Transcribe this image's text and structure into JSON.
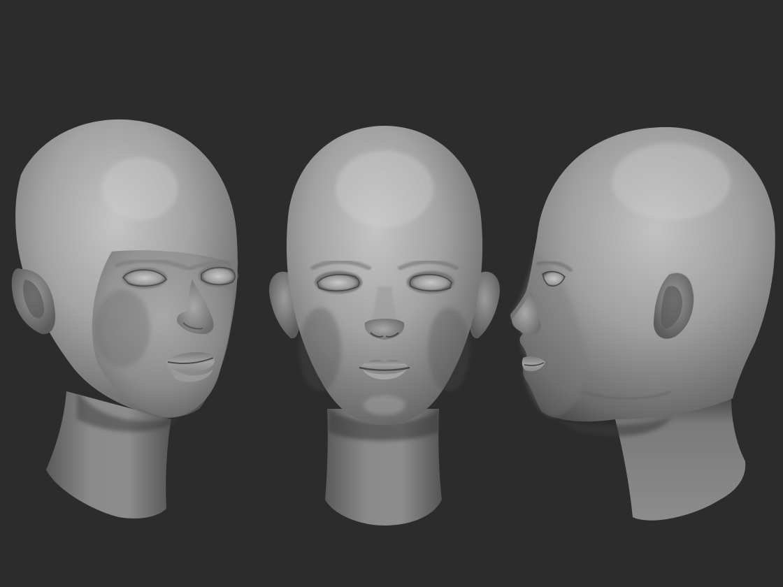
{
  "scene": {
    "background_color": "#2c2c2c",
    "material_color": "#8f8f8f",
    "subject": "sculpted-head",
    "views": [
      {
        "name": "three-quarter-view"
      },
      {
        "name": "front-view"
      },
      {
        "name": "profile-view"
      }
    ]
  }
}
